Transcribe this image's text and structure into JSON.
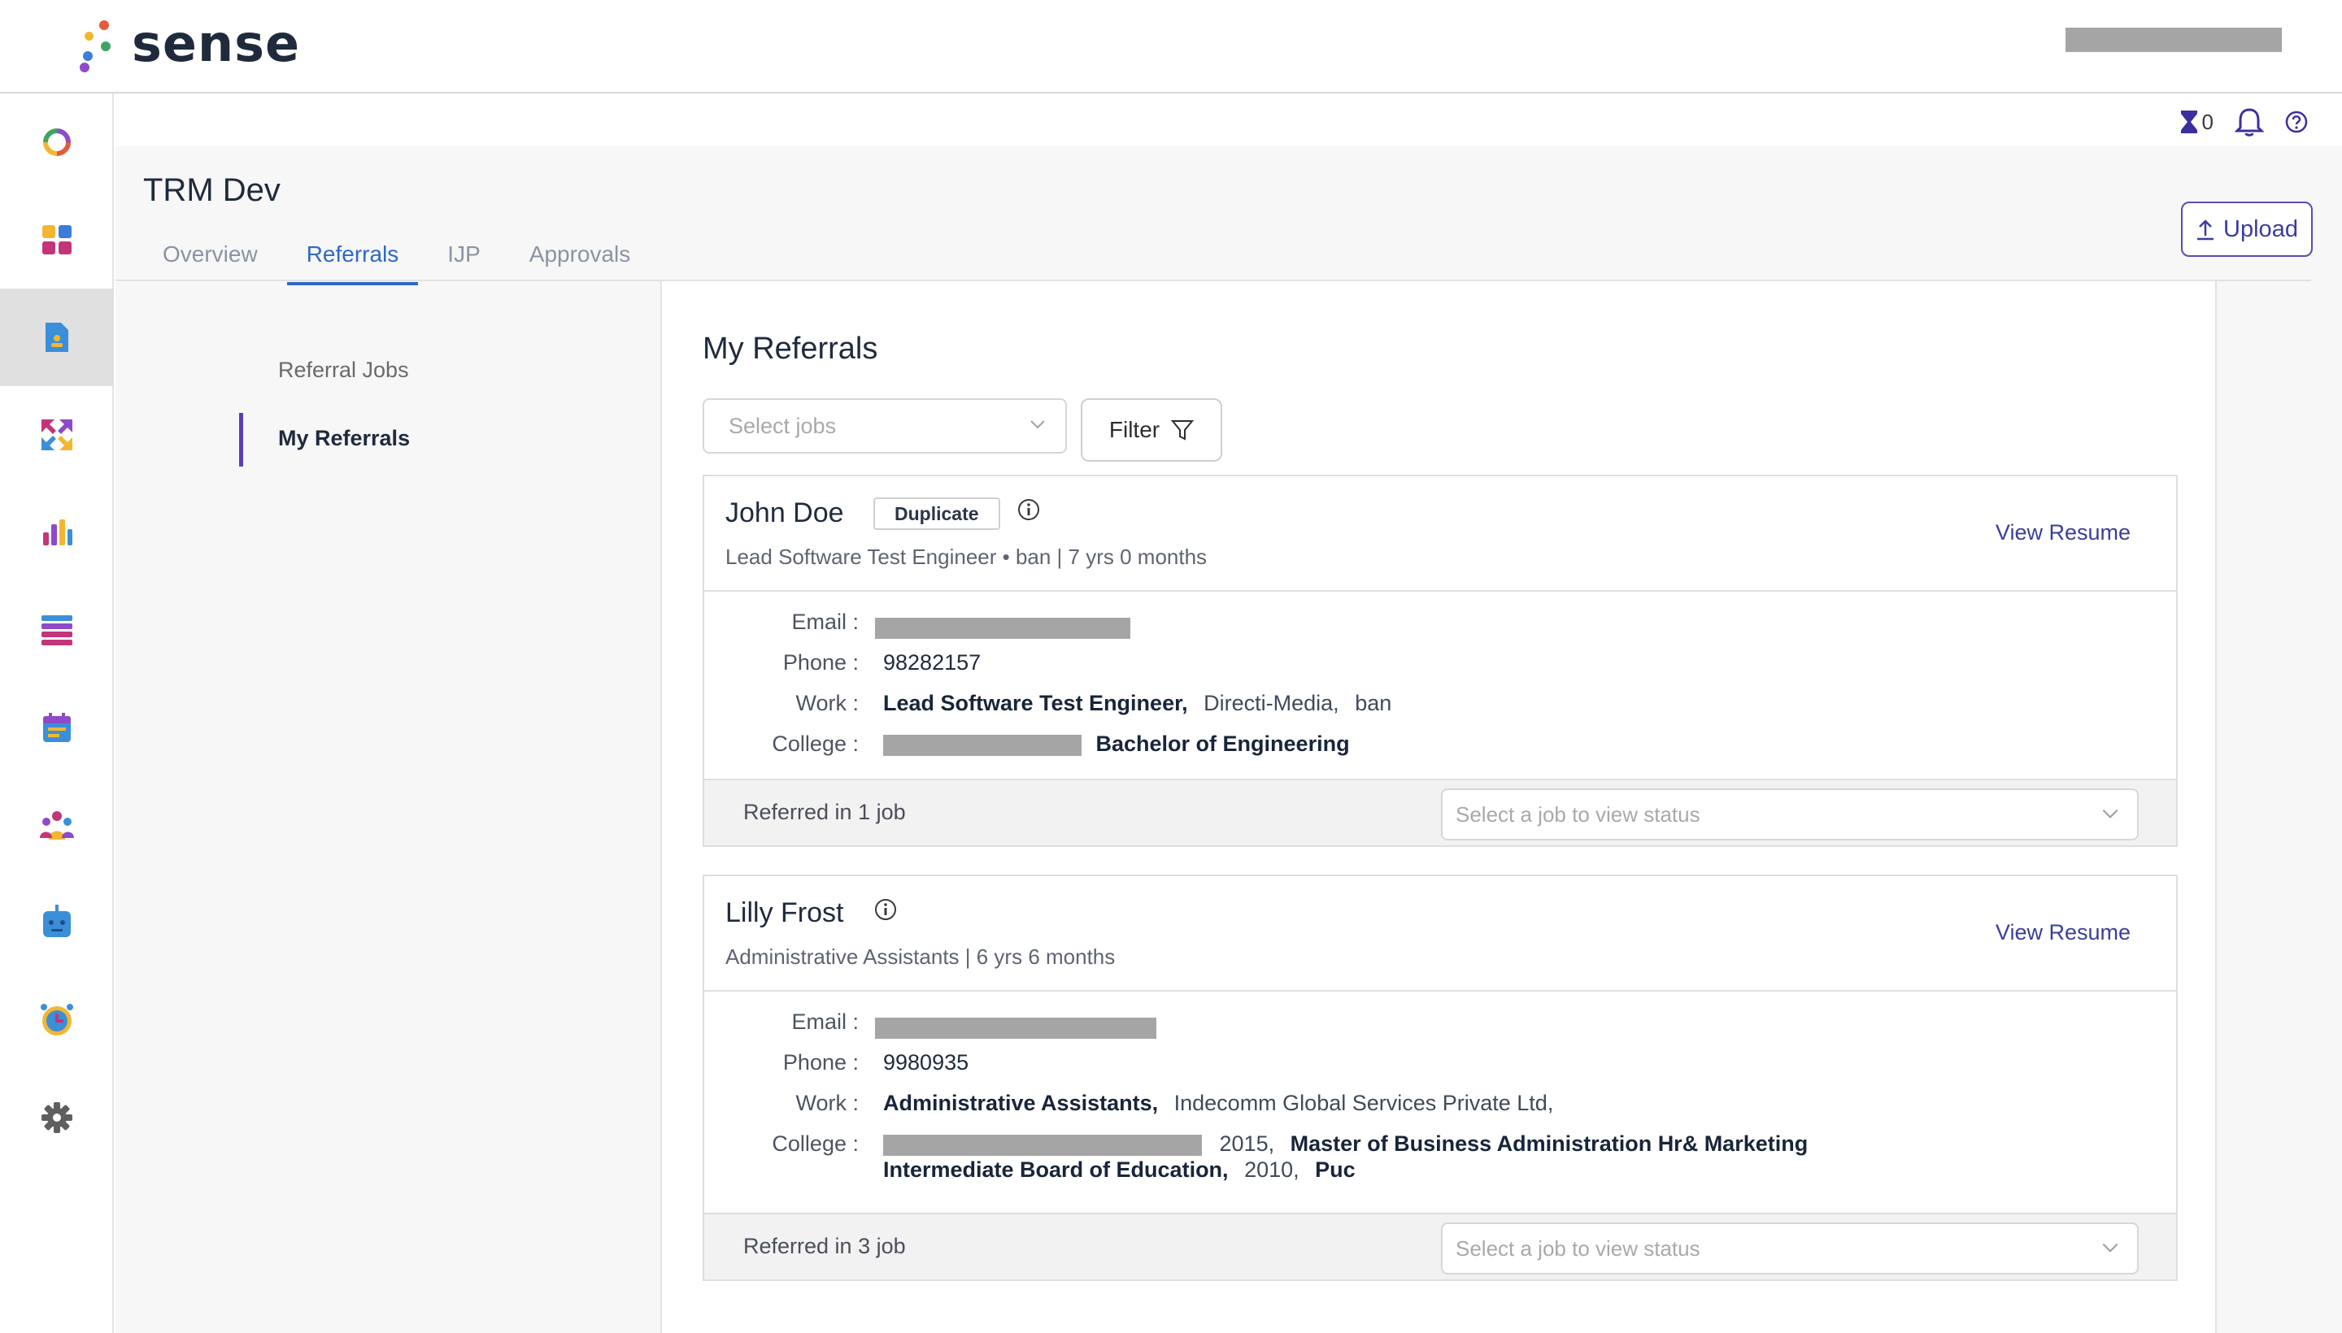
{
  "app": {
    "name": "sense"
  },
  "header": {
    "task_count": "0"
  },
  "page": {
    "title": "TRM Dev"
  },
  "tabs": [
    {
      "label": "Overview"
    },
    {
      "label": "Referrals"
    },
    {
      "label": "IJP"
    },
    {
      "label": "Approvals"
    }
  ],
  "upload": {
    "label": "Upload"
  },
  "subnav": [
    {
      "label": "Referral Jobs"
    },
    {
      "label": "My Referrals"
    }
  ],
  "main": {
    "title": "My Referrals",
    "select_placeholder": "Select jobs",
    "filter_label": "Filter"
  },
  "labels": {
    "email": "Email :",
    "phone": "Phone :",
    "work": "Work :",
    "college": "College :",
    "view_resume": "View Resume",
    "status_placeholder": "Select a job to view status"
  },
  "candidates": [
    {
      "name": "John Doe",
      "badge": "Duplicate",
      "subtitle": "Lead Software Test Engineer • ban | 7 yrs 0 months",
      "phone": "98282157",
      "work_title": "Lead Software Test Engineer,",
      "work_company": "Directi-Media,",
      "work_location": "ban",
      "college_degree": "Bachelor of Engineering",
      "referred": "Referred in 1 job"
    },
    {
      "name": "Lilly Frost",
      "subtitle": "Administrative Assistants | 6 yrs 6 months",
      "phone": "9980935",
      "work_title": "Administrative Assistants,",
      "work_company": "Indecomm Global Services Private Ltd,",
      "college_year": "2015,",
      "college_degree": "Master of Business Administration Hr& Marketing",
      "college2_name": "Intermediate Board of Education,",
      "college2_year": "2010,",
      "college2_degree": "Puc",
      "referred": "Referred in 3 job"
    }
  ],
  "colors": {
    "accent": "#2f68c4",
    "brand_purple": "#5b3fb4",
    "link": "#3b3f9a",
    "logo_dots": [
      "#e35b3b",
      "#f2b632",
      "#3fa463",
      "#3b7dd8",
      "#8e4ac9"
    ]
  },
  "icons": {
    "rail": [
      "sense-ring-icon",
      "dashboard-grid-icon",
      "referral-document-icon",
      "swap-arrows-icon",
      "analytics-bars-icon",
      "list-icon",
      "calendar-icon",
      "team-icon",
      "bot-icon",
      "alarm-clock-icon",
      "settings-gear-icon"
    ],
    "utility": [
      "hourglass-icon",
      "bell-icon",
      "help-icon"
    ]
  }
}
